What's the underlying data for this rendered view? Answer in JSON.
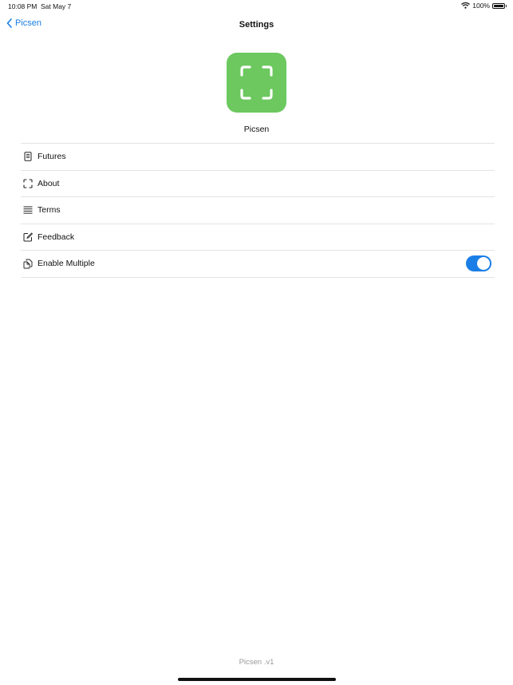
{
  "status_bar": {
    "time": "10:08 PM",
    "date": "Sat May 7",
    "battery_percent": "100%",
    "battery_level": 1.0
  },
  "nav": {
    "back_label": "Picsen",
    "title": "Settings"
  },
  "app": {
    "name": "Picsen",
    "icon": "scan-frame-icon",
    "icon_color": "#6cc85f"
  },
  "settings": {
    "items": [
      {
        "label": "Futures",
        "icon": "document-icon"
      },
      {
        "label": "About",
        "icon": "scan-frame-icon"
      },
      {
        "label": "Terms",
        "icon": "lines-icon"
      },
      {
        "label": "Feedback",
        "icon": "compose-icon"
      },
      {
        "label": "Enable Multiple",
        "icon": "copy-docs-icon",
        "toggle_on": true
      }
    ]
  },
  "footer": {
    "version": "Picsen .v1"
  },
  "colors": {
    "accent": "#1a7ee6",
    "separator": "#e4e4e4"
  }
}
